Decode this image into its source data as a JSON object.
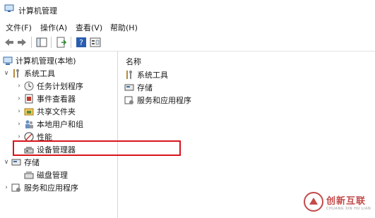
{
  "window": {
    "title": "计算机管理"
  },
  "menu": [
    "文件(F)",
    "操作(A)",
    "查看(V)",
    "帮助(H)"
  ],
  "tree": {
    "root": "计算机管理(本地)",
    "system_tools": "系统工具",
    "task_scheduler": "任务计划程序",
    "event_viewer": "事件查看器",
    "shared_folders": "共享文件夹",
    "local_users": "本地用户和组",
    "performance": "性能",
    "device_manager": "设备管理器",
    "storage": "存储",
    "disk_management": "磁盘管理",
    "services_apps": "服务和应用程序"
  },
  "list": {
    "header": "名称",
    "items": [
      "系统工具",
      "存储",
      "服务和应用程序"
    ]
  },
  "watermark": {
    "cn": "创新互联",
    "en": "CHUANG XIN HU LIAN"
  },
  "colors": {
    "highlight": "#d7141b",
    "accent": "#0078d7"
  }
}
